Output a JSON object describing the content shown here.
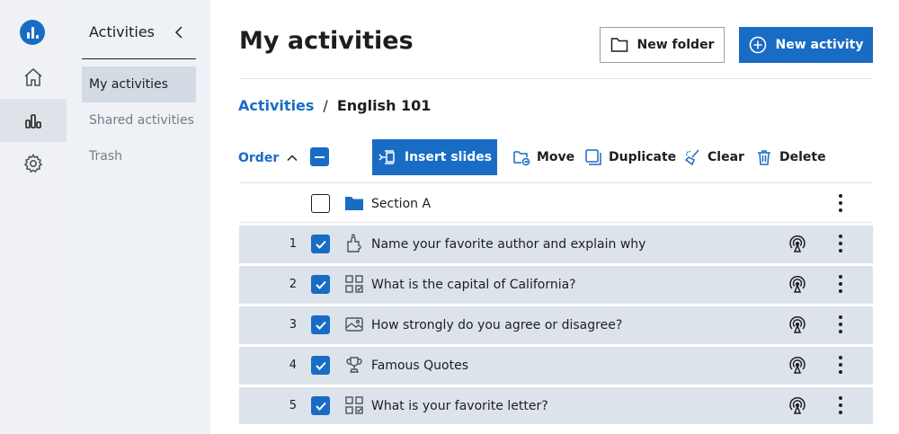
{
  "rail": {
    "items": [
      "home-icon",
      "activities-chart-icon",
      "settings-icon"
    ],
    "active_index": 1
  },
  "sidebar": {
    "title": "Activities",
    "items": [
      {
        "label": "My activities",
        "active": true
      },
      {
        "label": "Shared activities",
        "active": false
      },
      {
        "label": "Trash",
        "active": false
      }
    ]
  },
  "header": {
    "title": "My activities",
    "new_folder_label": "New folder",
    "new_activity_label": "New activity"
  },
  "breadcrumb": {
    "root": "Activities",
    "separator": "/",
    "current": "English 101"
  },
  "toolbar": {
    "order_label": "Order",
    "insert_slides_label": "Insert slides",
    "move_label": "Move",
    "duplicate_label": "Duplicate",
    "clear_label": "Clear",
    "delete_label": "Delete"
  },
  "rows": [
    {
      "number": "",
      "label": "Section A",
      "type": "folder-icon",
      "checked": false
    },
    {
      "number": "1",
      "label": "Name your favorite author and explain why",
      "type": "puzzle-icon",
      "checked": true
    },
    {
      "number": "2",
      "label": "What is the capital of California?",
      "type": "grid-icon",
      "checked": true
    },
    {
      "number": "3",
      "label": "How strongly do you agree or disagree?",
      "type": "image-icon",
      "checked": true
    },
    {
      "number": "4",
      "label": "Famous Quotes",
      "type": "trophy-icon",
      "checked": true
    },
    {
      "number": "5",
      "label": "What is your favorite letter?",
      "type": "grid-icon",
      "checked": true
    }
  ],
  "colors": {
    "accent": "#196cc4",
    "selected_row": "#dde3ea",
    "sidebar_bg": "#eef1f5"
  }
}
